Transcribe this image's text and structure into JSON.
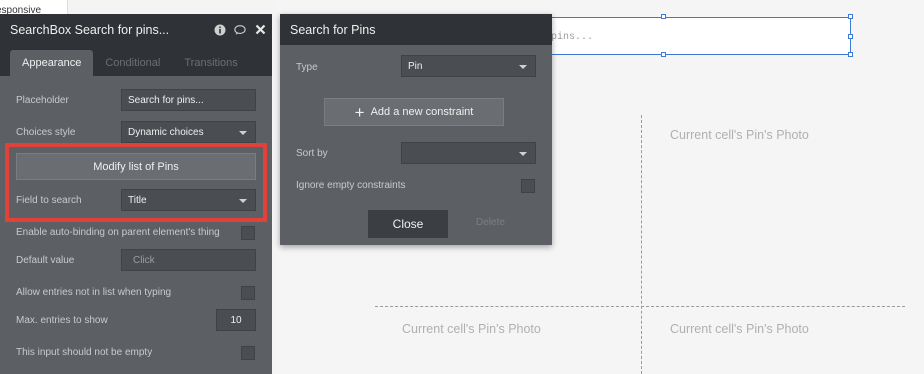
{
  "editor": {
    "left_strip_text": "esponsive"
  },
  "canvas": {
    "searchbox_placeholder": "pins...",
    "cells": [
      "Current cell's Pin's Photo",
      "Current cell's Pin's Photo",
      "Current cell's Pin's Photo"
    ]
  },
  "property_panel": {
    "title": "SearchBox Search for pins...",
    "tabs": [
      "Appearance",
      "Conditional",
      "Transitions"
    ],
    "placeholder_label": "Placeholder",
    "placeholder_value": "Search for pins...",
    "choices_style_label": "Choices style",
    "choices_style_value": "Dynamic choices",
    "modify_button": "Modify list of Pins",
    "field_to_search_label": "Field to search",
    "field_to_search_value": "Title",
    "auto_binding_label": "Enable auto-binding on parent element's thing",
    "default_value_label": "Default value",
    "default_value_placeholder": "Click",
    "allow_entries_label": "Allow entries not in list when typing",
    "max_entries_label": "Max. entries to show",
    "max_entries_value": "10",
    "not_empty_label": "This input should not be empty",
    "highlight_color": "#e0423a"
  },
  "popup": {
    "title": "Search for Pins",
    "type_label": "Type",
    "type_value": "Pin",
    "add_constraint_button": "Add a new constraint",
    "sort_by_label": "Sort by",
    "ignore_empty_label": "Ignore empty constraints",
    "close_button": "Close",
    "delete_button": "Delete"
  }
}
